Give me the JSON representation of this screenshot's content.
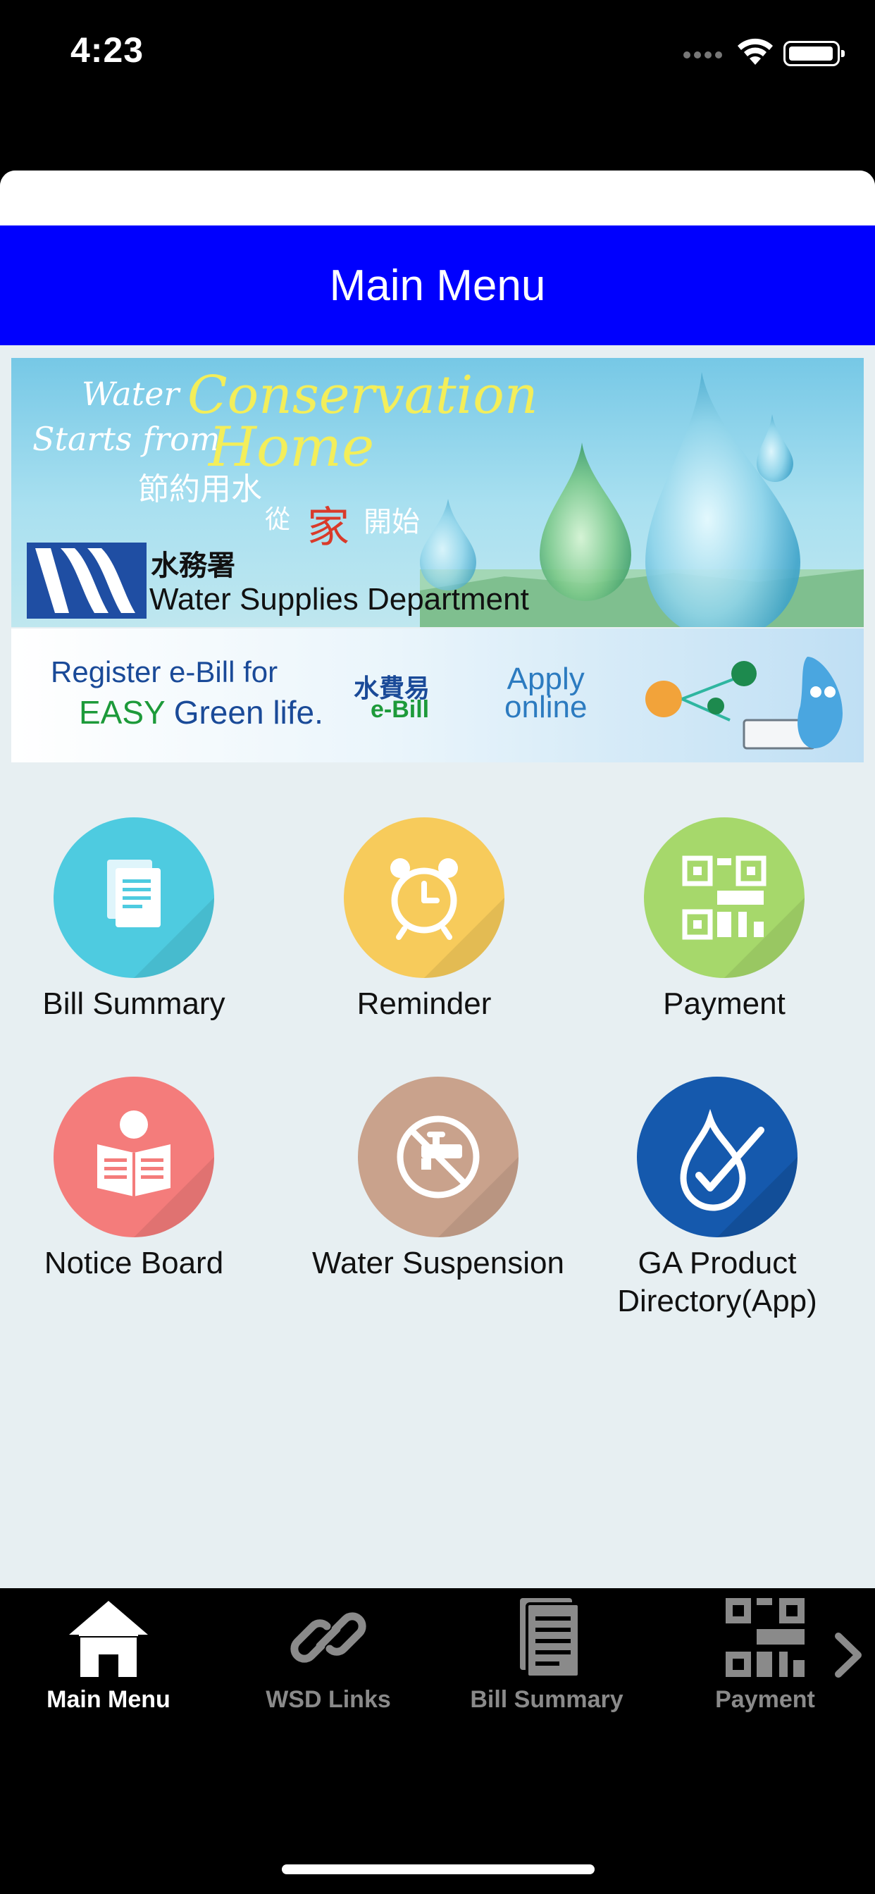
{
  "status_bar": {
    "time": "4:23"
  },
  "header": {
    "title": "Main Menu"
  },
  "banner_conservation": {
    "line1_small": "Water",
    "line1_large": "Conservation",
    "line2_small": "Starts from",
    "line2_large": "Home",
    "chinese_line1": "節約用水",
    "chinese_line2_pre": "從",
    "chinese_line2_big": "家",
    "chinese_line2_post": "開始",
    "dept_cn": "水務署",
    "dept_en": "Water Supplies Department"
  },
  "banner_ebill": {
    "register": "Register e-Bill for",
    "easy": "EASY",
    "green_life": "Green life.",
    "ebill_cn": "水費易",
    "ebill": "e-Bill",
    "apply_line1": "Apply",
    "apply_line2": "online"
  },
  "menu": {
    "items": [
      {
        "label": "Bill Summary",
        "color": "#4ecbe0"
      },
      {
        "label": "Reminder",
        "color": "#f7cb5b"
      },
      {
        "label": "Payment",
        "color": "#a6d86b"
      },
      {
        "label": "Notice Board",
        "color": "#f47c7b"
      },
      {
        "label": "Water Suspension",
        "color": "#c9a28c"
      },
      {
        "label_line1": "GA Product",
        "label_line2": "Directory(App)",
        "color": "#1559ad"
      }
    ]
  },
  "tabbar": {
    "tabs": [
      {
        "label": "Main Menu",
        "active": true
      },
      {
        "label": "WSD Links",
        "active": false
      },
      {
        "label": "Bill Summary",
        "active": false
      },
      {
        "label": "Payment",
        "active": false
      }
    ]
  }
}
